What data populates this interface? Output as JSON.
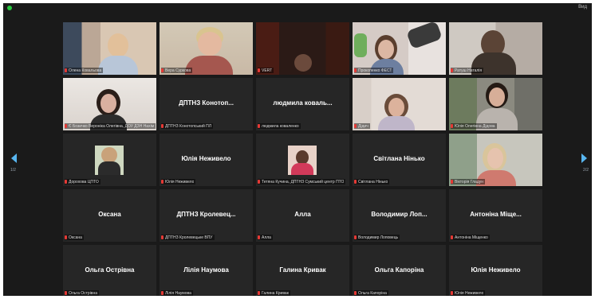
{
  "toolbar": {
    "view_label": "Вид"
  },
  "nav": {
    "page_left": "1/2",
    "page_right": "2/2"
  },
  "colors": {
    "active_speaker": "#d8d43a",
    "muted_mic": "#e53935",
    "nav_arrow": "#58b6f0",
    "tile_bg": "#262626"
  },
  "tiles": [
    {
      "label": "Олена Ковальова"
    },
    {
      "label": "Вера Суркова"
    },
    {
      "label": "VERT"
    },
    {
      "label": "Прокопенко ФЕСТ"
    },
    {
      "label": "Ратуш Наталія"
    },
    {
      "label": "Є Бозичко Вероніка Олегівна, ДОУ ДЗН Нахімова"
    },
    {
      "name": "ДПТНЗ Конотоп...",
      "label": "ДПТНЗ Конотопський ПЛ"
    },
    {
      "name": "людмила коваль...",
      "label": "людмила коваленко"
    },
    {
      "label": "Дідич"
    },
    {
      "label": "Юлія Олегівна Дідова"
    },
    {
      "label": "Дорохова ЦПТО"
    },
    {
      "name": "Юлія Неживело",
      "label": "Юлія Неживело"
    },
    {
      "label": "Тетяна Кучина, ДПТНЗ Сумський центр ПТО"
    },
    {
      "name": "Світлана Нінько",
      "label": "Світлана Нінько"
    },
    {
      "label": "Вікторія Гладун"
    },
    {
      "name": "Оксана",
      "label": "Оксана"
    },
    {
      "name": "ДПТНЗ Кролевец...",
      "label": "ДПТНЗ Кролевецьке ВПУ"
    },
    {
      "name": "Алла",
      "label": "Алла"
    },
    {
      "name": "Володимир Лоп...",
      "label": "Володимир Лоповець"
    },
    {
      "name": "Антоніна Міще...",
      "label": "Антоніна Міщенко"
    },
    {
      "name": "Ольга Острівна",
      "label": "Ольга Острівна"
    },
    {
      "name": "Лілія Наумова",
      "label": "Лілія Наумова"
    },
    {
      "name": "Галина Кривак",
      "label": "Галина Кривак"
    },
    {
      "name": "Ольга Капоріна",
      "label": "Ольга Капоріна"
    },
    {
      "name": "Юлія Неживело",
      "label": "Юлія Неживело"
    }
  ]
}
